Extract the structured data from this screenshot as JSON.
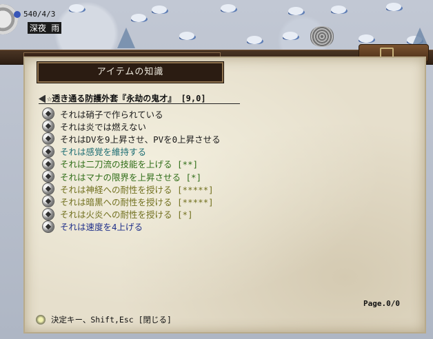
{
  "hud": {
    "date": "540/4/3",
    "time": "深夜 雨"
  },
  "window": {
    "title": "アイテムの知識",
    "back_title": "",
    "item_name": "☆透き通る防護外套『永劫の鬼才』 [9,0]",
    "page": "Page.0/0",
    "hint": "決定キー、Shift,Esc [閉じる]"
  },
  "properties": [
    {
      "text": "それは硝子で作られている",
      "color": "black",
      "icon": "material-icon"
    },
    {
      "text": "それは炎では燃えない",
      "color": "black",
      "icon": "fireproof-icon"
    },
    {
      "text": "それはDVを9上昇させ、PVを0上昇させる",
      "color": "black",
      "icon": "defense-icon"
    },
    {
      "text": "それは感覚を維持する",
      "color": "teal",
      "icon": "sustain-icon"
    },
    {
      "text": "それは二刀流の技能を上げる [**]",
      "color": "green",
      "icon": "skill-icon"
    },
    {
      "text": "それはマナの限界を上昇させる [*]",
      "color": "green",
      "icon": "skill-icon"
    },
    {
      "text": "それは神経への耐性を授ける [*****]",
      "color": "olive",
      "icon": "resist-icon"
    },
    {
      "text": "それは暗黒への耐性を授ける [*****]",
      "color": "olive",
      "icon": "resist-icon"
    },
    {
      "text": "それは火炎への耐性を授ける [*]",
      "color": "olive",
      "icon": "resist-icon"
    },
    {
      "text": "それは速度を4上げる",
      "color": "blue",
      "icon": "speed-icon"
    }
  ]
}
